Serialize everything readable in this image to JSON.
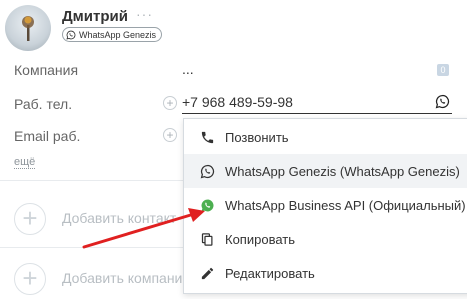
{
  "contact": {
    "name": "Дмитрий",
    "more_dots": "···",
    "badge_label": "WhatsApp Genezis"
  },
  "fields": {
    "company_label": "Компания",
    "company_value": "...",
    "company_count": "0",
    "work_phone_label": "Раб. тел.",
    "work_phone_value": "+7 968 489-59-98",
    "email_label": "Email раб.",
    "more_link": "ещё",
    "plus": "+"
  },
  "actions": {
    "add_contact": "Добавить контакт",
    "add_company": "Добавить компанию",
    "plus": "+"
  },
  "menu": {
    "items": [
      {
        "label": "Позвонить",
        "icon": "phone-icon"
      },
      {
        "label": "WhatsApp Genezis (WhatsApp Genezis)",
        "icon": "whatsapp-outline-icon"
      },
      {
        "label": "WhatsApp Business API (Официальный)",
        "icon": "whatsapp-green-icon"
      },
      {
        "label": "Копировать",
        "icon": "copy-icon"
      },
      {
        "label": "Редактировать",
        "icon": "pencil-icon"
      }
    ]
  },
  "colors": {
    "whatsapp_green": "#4caf50",
    "annotation_arrow": "#e02020",
    "menu_hover": "#f1f3f5"
  }
}
